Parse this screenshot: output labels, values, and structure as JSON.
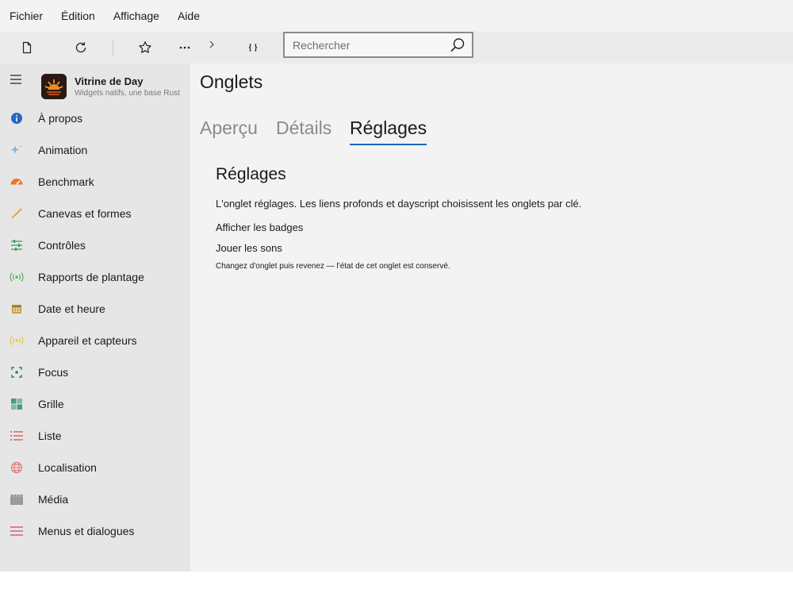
{
  "menubar": {
    "items": [
      "Fichier",
      "Édition",
      "Affichage",
      "Aide"
    ]
  },
  "toolbar": {
    "icons": [
      "new-file-icon",
      "refresh-icon",
      "star-icon",
      "more-icon",
      "chevron-right-icon",
      "braces-icon"
    ],
    "search": {
      "placeholder": "Rechercher",
      "value": ""
    }
  },
  "sidebar": {
    "app_title": "Vitrine de Day",
    "app_subtitle": "Widgets natifs, une base Rust",
    "items": [
      {
        "label": "À propos",
        "icon": "info-icon",
        "color": "#2b67c1"
      },
      {
        "label": "Animation",
        "icon": "sparkle-icon",
        "color": "#7ab3e6"
      },
      {
        "label": "Benchmark",
        "icon": "speedometer-icon",
        "color": "#e7782c"
      },
      {
        "label": "Canevas et formes",
        "icon": "brush-icon",
        "color": "#e8a33c"
      },
      {
        "label": "Contrôles",
        "icon": "sliders-icon",
        "color": "#3a9a5a"
      },
      {
        "label": "Rapports de plantage",
        "icon": "broadcast-icon",
        "color": "#4caf50"
      },
      {
        "label": "Date et heure",
        "icon": "calendar-icon",
        "color": "#c8a347"
      },
      {
        "label": "Appareil et capteurs",
        "icon": "sensor-icon",
        "color": "#e8c23c"
      },
      {
        "label": "Focus",
        "icon": "focus-icon",
        "color": "#2e7d6a"
      },
      {
        "label": "Grille",
        "icon": "grid-icon",
        "color": "#4a9a8a"
      },
      {
        "label": "Liste",
        "icon": "list-icon",
        "color": "#d94a4a"
      },
      {
        "label": "Localisation",
        "icon": "globe-icon",
        "color": "#e07a7a"
      },
      {
        "label": "Média",
        "icon": "clapperboard-icon",
        "color": "#9a9a9a"
      },
      {
        "label": "Menus et dialogues",
        "icon": "menu-lines-icon",
        "color": "#d95c7a"
      }
    ]
  },
  "main": {
    "page_title": "Onglets",
    "tabs": [
      {
        "label": "Aperçu",
        "active": false
      },
      {
        "label": "Détails",
        "active": false
      },
      {
        "label": "Réglages",
        "active": true
      }
    ],
    "section_title": "Réglages",
    "description": "L'onglet réglages. Les liens profonds et dayscript choisissent les onglets par clé.",
    "options": [
      "Afficher les badges",
      "Jouer les sons"
    ],
    "note": "Changez d'onglet puis revenez — l'état de cet onglet est conservé."
  },
  "colors": {
    "accent": "#0f6cbd",
    "sidebar_bg": "#e6e6e6",
    "main_bg": "#f3f3f3"
  }
}
